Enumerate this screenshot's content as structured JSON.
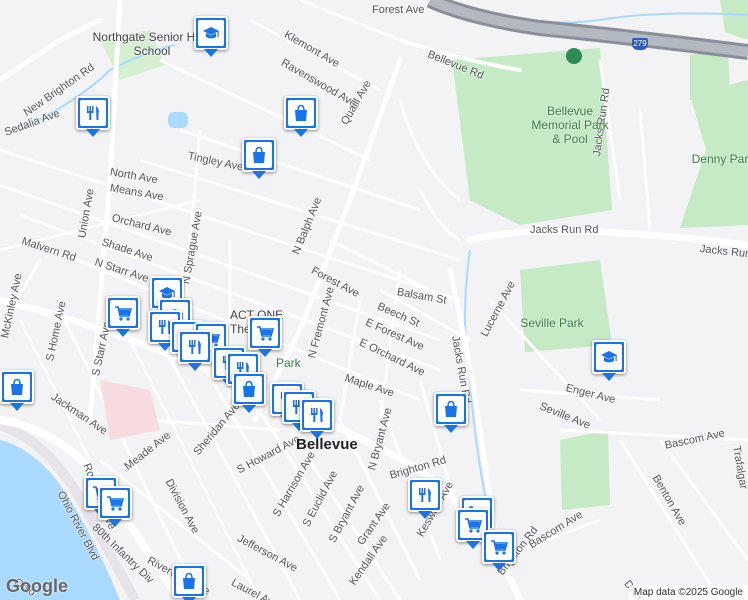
{
  "map": {
    "streets": [
      "Forest Ave",
      "Klemont Ave",
      "Ravenswood Ave",
      "Quaill Ave",
      "Bellevue Rd",
      "New Brighton Rd",
      "Sedalia Ave",
      "Tingley Ave",
      "North Ave",
      "Means Ave",
      "Orchard Ave",
      "Union Ave",
      "Malvern Rd",
      "Shade Ave",
      "N Starr Ave",
      "N Sprague Ave",
      "N Balph Ave",
      "Forest Ave",
      "Balsam St",
      "Beech St",
      "E Forest Ave",
      "E Orchard Ave",
      "N Fremont Ave",
      "Maple Ave",
      "Jacks Run Rd",
      "Jacks Run Rd",
      "Jacks Run Rd",
      "Lucerne Ave",
      "Enger Ave",
      "Seville Ave",
      "Bascom Ave",
      "Benton Ave",
      "McKinley Ave",
      "S Home Ave",
      "S Starr Ave",
      "Jackman Ave",
      "Roosevelt Ave",
      "Meade Ave",
      "Division Ave",
      "Sheridan Ave",
      "S Howard Ave",
      "S Harrison Ave",
      "S Euclid Ave",
      "S Bryant Ave",
      "N Bryant Ave",
      "Brighton Rd",
      "Jefferson Ave",
      "Riverview Ave",
      "Laurel Ave",
      "Grant Ave",
      "Kendall Ave",
      "Keswick Ave",
      "Bascom Ave",
      "Drexel Rd",
      "Ohio River Blvd",
      "80th Infantry Div",
      "Ohio",
      "Jacks Run Rd",
      "Brighton Rd",
      "Trafalgar"
    ],
    "areas": [
      {
        "name": "Bellevue Memorial Park & Pool"
      },
      {
        "name": "Denny Park"
      },
      {
        "name": "Seville Park"
      }
    ],
    "places": [
      "Northgate Senior High School",
      "ACT ONE Theatre",
      "Park"
    ],
    "town": "Bellevue",
    "highway_shield": "279",
    "pins": [
      {
        "type": "school"
      },
      {
        "type": "restaurant"
      },
      {
        "type": "shopping"
      },
      {
        "type": "shopping"
      },
      {
        "type": "school"
      },
      {
        "type": "grocery"
      },
      {
        "type": "school"
      },
      {
        "type": "grocery"
      },
      {
        "type": "restaurant"
      },
      {
        "type": "restaurant"
      },
      {
        "type": "grocery"
      },
      {
        "type": "restaurant"
      },
      {
        "type": "restaurant"
      },
      {
        "type": "restaurant"
      },
      {
        "type": "shopping"
      },
      {
        "type": "restaurant"
      },
      {
        "type": "restaurant"
      },
      {
        "type": "restaurant"
      },
      {
        "type": "shopping"
      },
      {
        "type": "school"
      },
      {
        "type": "restaurant"
      },
      {
        "type": "grocery"
      },
      {
        "type": "grocery"
      },
      {
        "type": "grocery"
      },
      {
        "type": "shopping"
      },
      {
        "type": "shopping"
      },
      {
        "type": "grocery"
      },
      {
        "type": "grocery"
      }
    ],
    "colors": {
      "pin": "#1a73e8",
      "park": "#c6e9c6",
      "water": "#aadaff",
      "road": "#ffffff",
      "highway": "#8a8f99"
    }
  },
  "footer": {
    "logo": "Google",
    "attribution": "Map data ©2025 Google"
  }
}
